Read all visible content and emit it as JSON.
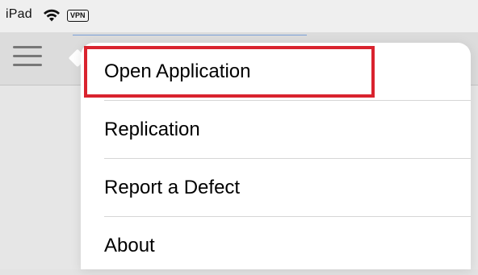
{
  "status_bar": {
    "device": "iPad",
    "wifi_icon": "wifi-icon",
    "vpn_badge": "VPN"
  },
  "nav_bar": {
    "menu_icon": "hamburger-icon"
  },
  "popover": {
    "items": [
      {
        "label": "Open Application",
        "highlighted": true
      },
      {
        "label": "Replication"
      },
      {
        "label": "Report a Defect"
      },
      {
        "label": "About"
      }
    ]
  },
  "colors": {
    "highlight": "#d9232e",
    "field_underline": "#7aa0d8"
  }
}
